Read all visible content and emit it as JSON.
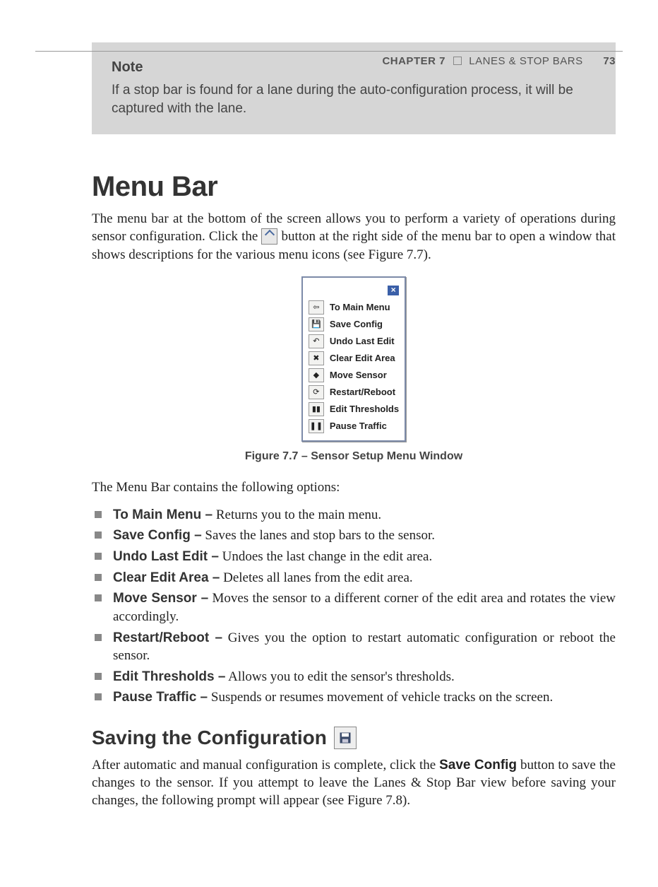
{
  "header": {
    "chapter": "CHAPTER 7",
    "title": "LANES & STOP BARS",
    "page": "73"
  },
  "note": {
    "label": "Note",
    "text": "If a stop bar is found for a lane during the auto-configuration process, it will be captured with the lane."
  },
  "section_title": "Menu Bar",
  "intro_before": "The menu bar at the bottom of the screen allows you to perform a variety of operations during sensor configuration. Click the ",
  "intro_after": " button at the right side of the menu bar to open a window that shows descriptions for the various menu icons (see Figure 7.7).",
  "menu_items": [
    {
      "icon": "back-arrow-icon",
      "glyph": "⇦",
      "label": "To Main Menu"
    },
    {
      "icon": "disk-icon",
      "glyph": "💾",
      "label": "Save Config"
    },
    {
      "icon": "undo-icon",
      "glyph": "↶",
      "label": "Undo Last Edit"
    },
    {
      "icon": "clear-icon",
      "glyph": "✖",
      "label": "Clear Edit Area"
    },
    {
      "icon": "move-icon",
      "glyph": "◆",
      "label": "Move Sensor"
    },
    {
      "icon": "restart-icon",
      "glyph": "⟳",
      "label": "Restart/Reboot"
    },
    {
      "icon": "thresholds-icon",
      "glyph": "▮▮",
      "label": "Edit Thresholds"
    },
    {
      "icon": "pause-icon",
      "glyph": "❚❚",
      "label": "Pause Traffic"
    }
  ],
  "figure_caption": "Figure 7.7 – Sensor Setup Menu Window",
  "options_intro": "The Menu Bar contains the following options:",
  "options": [
    {
      "term": "To Main Menu –",
      "desc": " Returns you to the main menu."
    },
    {
      "term": "Save Config –",
      "desc": " Saves the lanes and stop bars to the sensor."
    },
    {
      "term": "Undo Last Edit –",
      "desc": " Undoes the last change in the edit area."
    },
    {
      "term": "Clear Edit Area –",
      "desc": " Deletes all lanes from the edit area."
    },
    {
      "term": "Move Sensor –",
      "desc": " Moves the sensor to a different corner of the edit area and rotates the view accordingly."
    },
    {
      "term": "Restart/Reboot –",
      "desc": " Gives you the option to restart automatic configuration or reboot the sensor."
    },
    {
      "term": "Edit Thresholds –",
      "desc": " Allows you to edit the sensor's thresholds."
    },
    {
      "term": "Pause Traffic –",
      "desc": " Suspends or resumes movement of vehicle tracks on the screen."
    }
  ],
  "sub_heading": "Saving the Configuration",
  "saving_before": "After automatic and manual configuration is complete, click the ",
  "saving_bold": "Save Config",
  "saving_after": " button to save the changes to the sensor. If you attempt to leave the Lanes & Stop Bar view before saving your changes, the following prompt will appear (see Figure 7.8)."
}
